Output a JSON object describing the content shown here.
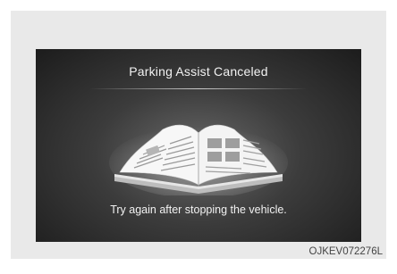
{
  "screen": {
    "title": "Parking Assist Canceled",
    "message": "Try again after stopping the vehicle.",
    "illustration_icon": "open-book-icon"
  },
  "figure": {
    "reference_code": "OJKEV072276L"
  },
  "colors": {
    "screen_background": "#2a2a2a",
    "frame_background": "#e9e9e9",
    "text": "#f2f2f2"
  }
}
